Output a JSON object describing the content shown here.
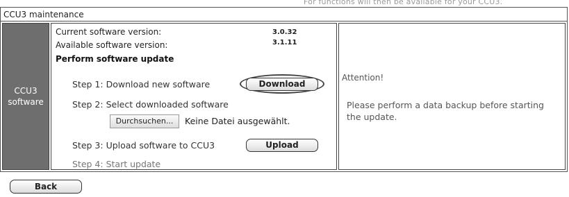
{
  "top_note": "For functions will then be available for your CCU3.",
  "title": "CCU3 maintenance",
  "sidebar": {
    "line1": "CCU3",
    "line2": "software"
  },
  "versions": {
    "current_label": "Current software version:",
    "current_value": "3.0.32",
    "available_label": "Available software version:",
    "available_value": "3.1.11"
  },
  "section_title": "Perform software update",
  "steps": {
    "step1": "Step 1: Download new software",
    "download_label": "Download",
    "step2": "Step 2: Select downloaded software",
    "browse_label": "Durchsuchen...",
    "no_file_text": "Keine Datei ausgewählt.",
    "step3": "Step 3: Upload software to CCU3",
    "upload_label": "Upload",
    "step4": "Step 4: Start update"
  },
  "attention": {
    "title": "Attention!",
    "message": "Please perform a data backup before starting the update."
  },
  "footer": {
    "back_label": "Back"
  }
}
